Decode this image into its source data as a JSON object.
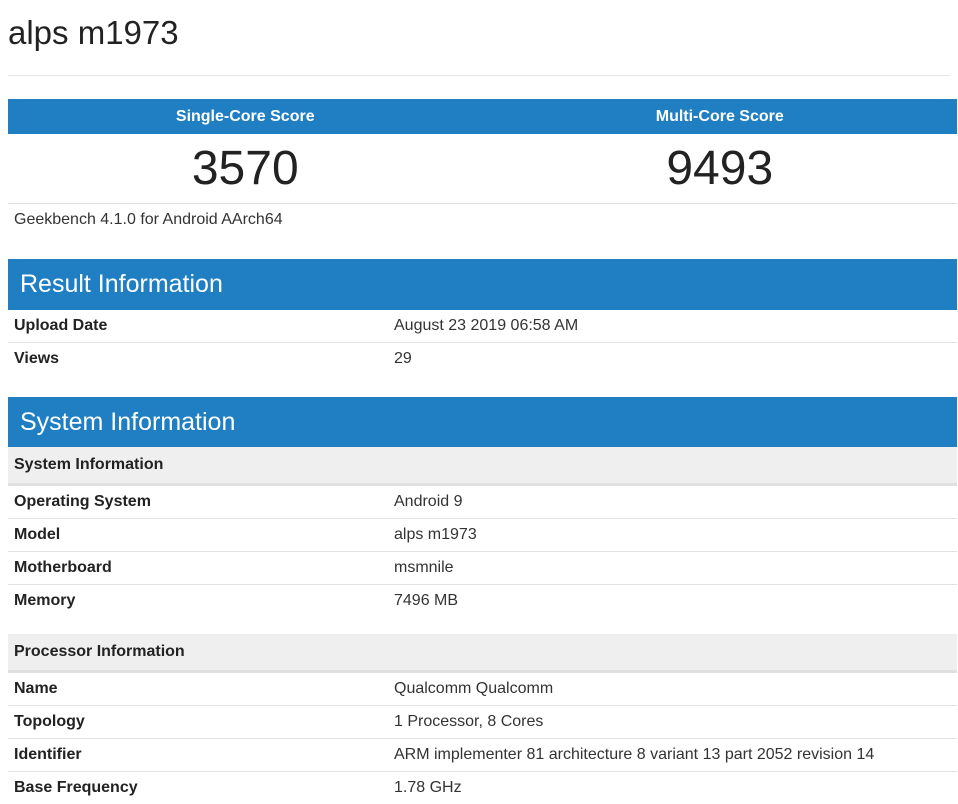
{
  "page": {
    "title": "alps m1973"
  },
  "scores": {
    "single_label": "Single-Core Score",
    "multi_label": "Multi-Core Score",
    "single_value": "3570",
    "multi_value": "9493",
    "version": "Geekbench 4.1.0 for Android AArch64"
  },
  "result_info": {
    "title": "Result Information",
    "rows": [
      {
        "key": "Upload Date",
        "value": "August 23 2019 06:58 AM"
      },
      {
        "key": "Views",
        "value": "29"
      }
    ]
  },
  "system_info": {
    "title": "System Information",
    "system_subhead": "System Information",
    "system_rows": [
      {
        "key": "Operating System",
        "value": "Android 9"
      },
      {
        "key": "Model",
        "value": "alps m1973"
      },
      {
        "key": "Motherboard",
        "value": "msmnile"
      },
      {
        "key": "Memory",
        "value": "7496 MB"
      }
    ],
    "processor_subhead": "Processor Information",
    "processor_rows": [
      {
        "key": "Name",
        "value": "Qualcomm Qualcomm"
      },
      {
        "key": "Topology",
        "value": "1 Processor, 8 Cores"
      },
      {
        "key": "Identifier",
        "value": "ARM implementer 81 architecture 8 variant 13 part 2052 revision 14"
      },
      {
        "key": "Base Frequency",
        "value": "1.78 GHz"
      }
    ]
  },
  "colors": {
    "header_blue": "#1f7fc2",
    "subhead_gray": "#efefef"
  }
}
